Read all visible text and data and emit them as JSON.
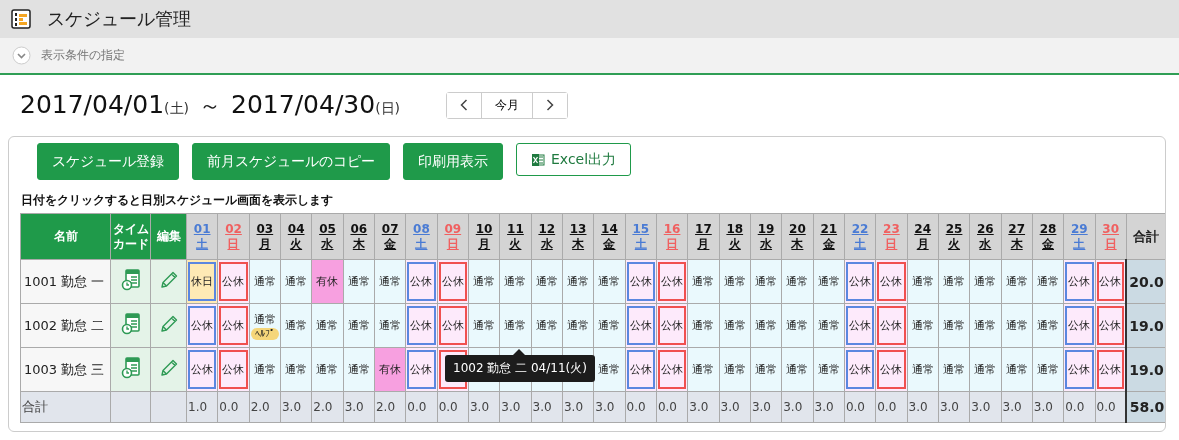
{
  "window": {
    "title": "スケジュール管理"
  },
  "filter": {
    "label": "表示条件の指定",
    "expanded": false
  },
  "range": {
    "start": "2017/04/01",
    "start_weekday": "(土)",
    "separator": "～",
    "end": "2017/04/30",
    "end_weekday": "(日)"
  },
  "nav": {
    "current": "今月"
  },
  "buttons": [
    {
      "label": "スケジュール登録",
      "kind": "primary"
    },
    {
      "label": "前月スケジュールのコピー",
      "kind": "primary"
    },
    {
      "label": "印刷用表示",
      "kind": "primary"
    },
    {
      "label": "Excel出力",
      "kind": "excel"
    }
  ],
  "hint": "日付をクリックすると日別スケジュール画面を表示します",
  "table": {
    "columns": {
      "name": "名前",
      "timecard": "タイムカード",
      "edit": "編集",
      "total": "合計"
    },
    "days": [
      {
        "date": "01",
        "weekday": "土",
        "kind": "sat"
      },
      {
        "date": "02",
        "weekday": "日",
        "kind": "sun"
      },
      {
        "date": "03",
        "weekday": "月",
        "kind": "weekday"
      },
      {
        "date": "04",
        "weekday": "火",
        "kind": "weekday"
      },
      {
        "date": "05",
        "weekday": "水",
        "kind": "weekday"
      },
      {
        "date": "06",
        "weekday": "木",
        "kind": "weekday"
      },
      {
        "date": "07",
        "weekday": "金",
        "kind": "weekday"
      },
      {
        "date": "08",
        "weekday": "土",
        "kind": "sat"
      },
      {
        "date": "09",
        "weekday": "日",
        "kind": "sun"
      },
      {
        "date": "10",
        "weekday": "月",
        "kind": "weekday"
      },
      {
        "date": "11",
        "weekday": "火",
        "kind": "weekday"
      },
      {
        "date": "12",
        "weekday": "水",
        "kind": "weekday"
      },
      {
        "date": "13",
        "weekday": "木",
        "kind": "weekday"
      },
      {
        "date": "14",
        "weekday": "金",
        "kind": "weekday"
      },
      {
        "date": "15",
        "weekday": "土",
        "kind": "sat"
      },
      {
        "date": "16",
        "weekday": "日",
        "kind": "sun"
      },
      {
        "date": "17",
        "weekday": "月",
        "kind": "weekday"
      },
      {
        "date": "18",
        "weekday": "火",
        "kind": "weekday"
      },
      {
        "date": "19",
        "weekday": "水",
        "kind": "weekday"
      },
      {
        "date": "20",
        "weekday": "木",
        "kind": "weekday"
      },
      {
        "date": "21",
        "weekday": "金",
        "kind": "weekday"
      },
      {
        "date": "22",
        "weekday": "土",
        "kind": "sat"
      },
      {
        "date": "23",
        "weekday": "日",
        "kind": "sun"
      },
      {
        "date": "24",
        "weekday": "月",
        "kind": "weekday"
      },
      {
        "date": "25",
        "weekday": "火",
        "kind": "weekday"
      },
      {
        "date": "26",
        "weekday": "水",
        "kind": "weekday"
      },
      {
        "date": "27",
        "weekday": "木",
        "kind": "weekday"
      },
      {
        "date": "28",
        "weekday": "金",
        "kind": "weekday"
      },
      {
        "date": "29",
        "weekday": "土",
        "kind": "sat"
      },
      {
        "date": "30",
        "weekday": "日",
        "kind": "sun"
      }
    ],
    "rows": [
      {
        "name": "1001 勤怠 一",
        "total": "20.0",
        "cells": [
          {
            "text": "休日",
            "kind": "dayoff"
          },
          {
            "text": "公休",
            "kind": "public"
          },
          {
            "text": "通常",
            "kind": "normal"
          },
          {
            "text": "通常",
            "kind": "normal"
          },
          {
            "text": "有休",
            "kind": "paid"
          },
          {
            "text": "通常",
            "kind": "normal"
          },
          {
            "text": "通常",
            "kind": "normal"
          },
          {
            "text": "公休",
            "kind": "public"
          },
          {
            "text": "公休",
            "kind": "public"
          },
          {
            "text": "通常",
            "kind": "normal"
          },
          {
            "text": "通常",
            "kind": "normal"
          },
          {
            "text": "通常",
            "kind": "normal"
          },
          {
            "text": "通常",
            "kind": "normal"
          },
          {
            "text": "通常",
            "kind": "normal"
          },
          {
            "text": "公休",
            "kind": "public"
          },
          {
            "text": "公休",
            "kind": "public"
          },
          {
            "text": "通常",
            "kind": "normal"
          },
          {
            "text": "通常",
            "kind": "normal"
          },
          {
            "text": "通常",
            "kind": "normal"
          },
          {
            "text": "通常",
            "kind": "normal"
          },
          {
            "text": "通常",
            "kind": "normal"
          },
          {
            "text": "公休",
            "kind": "public"
          },
          {
            "text": "公休",
            "kind": "public"
          },
          {
            "text": "通常",
            "kind": "normal"
          },
          {
            "text": "通常",
            "kind": "normal"
          },
          {
            "text": "通常",
            "kind": "normal"
          },
          {
            "text": "通常",
            "kind": "normal"
          },
          {
            "text": "通常",
            "kind": "normal"
          },
          {
            "text": "公休",
            "kind": "public"
          },
          {
            "text": "公休",
            "kind": "public"
          }
        ]
      },
      {
        "name": "1002 勤怠 二",
        "total": "19.0",
        "cells": [
          {
            "text": "公休",
            "kind": "public"
          },
          {
            "text": "公休",
            "kind": "public"
          },
          {
            "text": "通常",
            "kind": "normal",
            "badge": "ﾍﾙﾌﾟ"
          },
          {
            "text": "通常",
            "kind": "normal"
          },
          {
            "text": "通常",
            "kind": "normal"
          },
          {
            "text": "通常",
            "kind": "normal"
          },
          {
            "text": "通常",
            "kind": "normal"
          },
          {
            "text": "公休",
            "kind": "public"
          },
          {
            "text": "公休",
            "kind": "public"
          },
          {
            "text": "通常",
            "kind": "normal"
          },
          {
            "text": "通常",
            "kind": "normal"
          },
          {
            "text": "通常",
            "kind": "normal"
          },
          {
            "text": "通常",
            "kind": "normal"
          },
          {
            "text": "通常",
            "kind": "normal"
          },
          {
            "text": "公休",
            "kind": "public"
          },
          {
            "text": "公休",
            "kind": "public"
          },
          {
            "text": "通常",
            "kind": "normal"
          },
          {
            "text": "通常",
            "kind": "normal"
          },
          {
            "text": "通常",
            "kind": "normal"
          },
          {
            "text": "通常",
            "kind": "normal"
          },
          {
            "text": "通常",
            "kind": "normal"
          },
          {
            "text": "公休",
            "kind": "public"
          },
          {
            "text": "公休",
            "kind": "public"
          },
          {
            "text": "通常",
            "kind": "normal"
          },
          {
            "text": "通常",
            "kind": "normal"
          },
          {
            "text": "通常",
            "kind": "normal"
          },
          {
            "text": "通常",
            "kind": "normal"
          },
          {
            "text": "通常",
            "kind": "normal"
          },
          {
            "text": "公休",
            "kind": "public"
          },
          {
            "text": "公休",
            "kind": "public"
          }
        ]
      },
      {
        "name": "1003 勤怠 三",
        "total": "19.0",
        "cells": [
          {
            "text": "公休",
            "kind": "public"
          },
          {
            "text": "公休",
            "kind": "public"
          },
          {
            "text": "通常",
            "kind": "normal"
          },
          {
            "text": "通常",
            "kind": "normal"
          },
          {
            "text": "通常",
            "kind": "normal"
          },
          {
            "text": "通常",
            "kind": "normal"
          },
          {
            "text": "有休",
            "kind": "paid"
          },
          {
            "text": "公休",
            "kind": "public"
          },
          {
            "kind": "public"
          },
          {
            "kind": "normal"
          },
          {
            "kind": "normal"
          },
          {
            "kind": "normal"
          },
          {
            "kind": "normal"
          },
          {
            "text": "通常",
            "kind": "normal"
          },
          {
            "text": "公休",
            "kind": "public"
          },
          {
            "text": "公休",
            "kind": "public"
          },
          {
            "text": "通常",
            "kind": "normal"
          },
          {
            "text": "通常",
            "kind": "normal"
          },
          {
            "text": "通常",
            "kind": "normal"
          },
          {
            "text": "通常",
            "kind": "normal"
          },
          {
            "text": "通常",
            "kind": "normal"
          },
          {
            "text": "公休",
            "kind": "public"
          },
          {
            "text": "公休",
            "kind": "public"
          },
          {
            "text": "通常",
            "kind": "normal"
          },
          {
            "text": "通常",
            "kind": "normal"
          },
          {
            "text": "通常",
            "kind": "normal"
          },
          {
            "text": "通常",
            "kind": "normal"
          },
          {
            "text": "通常",
            "kind": "normal"
          },
          {
            "text": "公休",
            "kind": "public"
          },
          {
            "text": "公休",
            "kind": "public"
          }
        ]
      }
    ],
    "totals": {
      "label": "合計",
      "values": [
        "1.0",
        "0.0",
        "2.0",
        "3.0",
        "2.0",
        "3.0",
        "2.0",
        "0.0",
        "0.0",
        "3.0",
        "3.0",
        "3.0",
        "3.0",
        "3.0",
        "0.0",
        "0.0",
        "3.0",
        "3.0",
        "3.0",
        "3.0",
        "3.0",
        "0.0",
        "0.0",
        "3.0",
        "3.0",
        "3.0",
        "3.0",
        "3.0",
        "0.0",
        "0.0"
      ],
      "total": "58.0"
    }
  },
  "tooltip": {
    "text": "1002 勤怠 二 04/11(火)"
  }
}
